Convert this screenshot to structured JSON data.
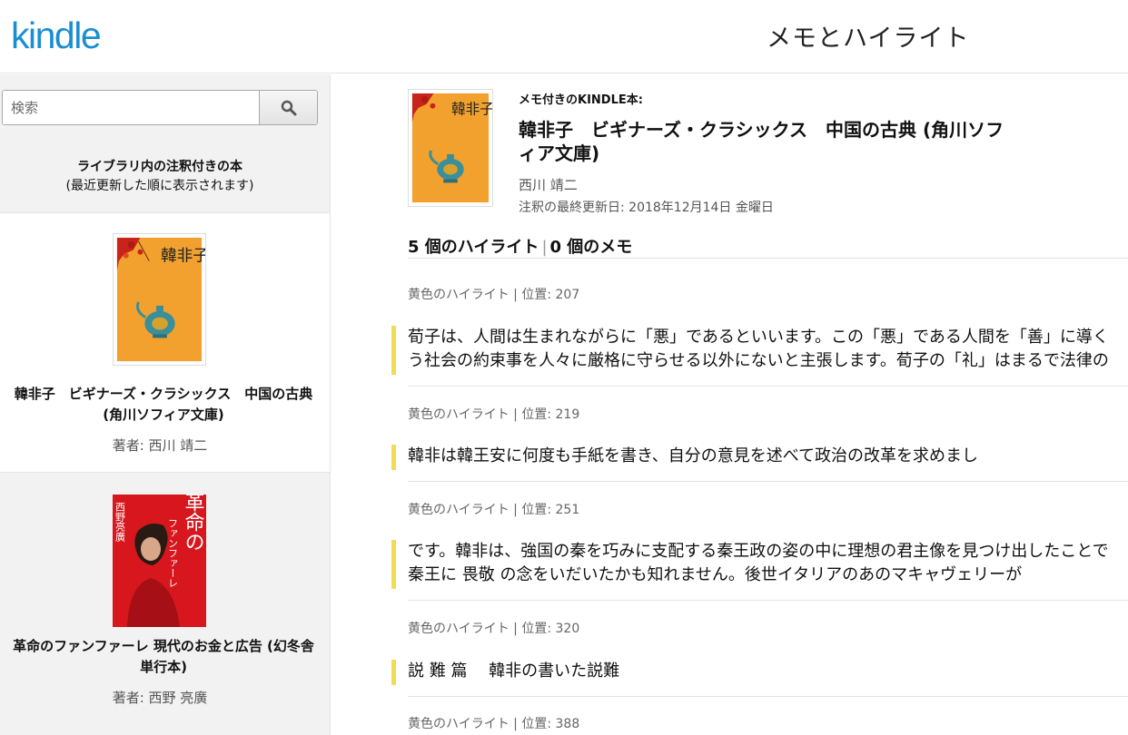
{
  "header": {
    "logo": "kindle",
    "title": "メモとハイライト"
  },
  "sidebar": {
    "search_placeholder": "検索",
    "caption_line1": "ライブラリ内の注釈付きの本",
    "caption_line2": "(最近更新した順に表示されます)",
    "books": [
      {
        "title": "韓非子　ビギナーズ・クラシックス　中国の古典 (角川ソフィア文庫)",
        "author": "著者: 西川 靖二"
      },
      {
        "title": "革命のファンファーレ 現代のお金と広告 (幻冬舎単行本)",
        "author": "著者: 西野 亮廣"
      }
    ]
  },
  "main": {
    "label": "メモ付きのKINDLE本:",
    "title": "韓非子　ビギナーズ・クラシックス　中国の古典 (角川ソフィア文庫)",
    "author": "西川 靖二",
    "updated": "注釈の最終更新日:  2018年12月14日 金曜日",
    "highlight_count": "5 個のハイライト",
    "note_count": "0 個のメモ",
    "highlights": [
      {
        "meta": "黄色のハイライト | 位置: 207",
        "line1": "荀子は、人間は生まれながらに「悪」であるといいます。この「悪」である人間を「善」に導く",
        "line2": "う社会の約束事を人々に厳格に守らせる以外にないと主張します。荀子の「礼」はまるで法律の"
      },
      {
        "meta": "黄色のハイライト | 位置: 219",
        "line1": "韓非は韓王安に何度も手紙を書き、自分の意見を述べて政治の改革を求めまし"
      },
      {
        "meta": "黄色のハイライト | 位置: 251",
        "line1": "です。韓非は、強国の秦を巧みに支配する秦王政の姿の中に理想の君主像を見つけ出したことで",
        "line2": "秦王に 畏敬 の念をいだいたかも知れません。後世イタリアのあのマキャヴェリーが"
      },
      {
        "meta": "黄色のハイライト | 位置: 320",
        "line1": "説 難 篇　 韓非の書いた説難"
      },
      {
        "meta": "黄色のハイライト | 位置: 388"
      }
    ]
  },
  "covers": {
    "kanpishi_bg": "#f2a12e",
    "kanpishi_title": "韓非子",
    "kakumei_bg": "#d7161d",
    "kakumei_title": "革命の",
    "kakumei_sub": "ファンファーレ",
    "kakumei_author": "西野亮廣"
  }
}
